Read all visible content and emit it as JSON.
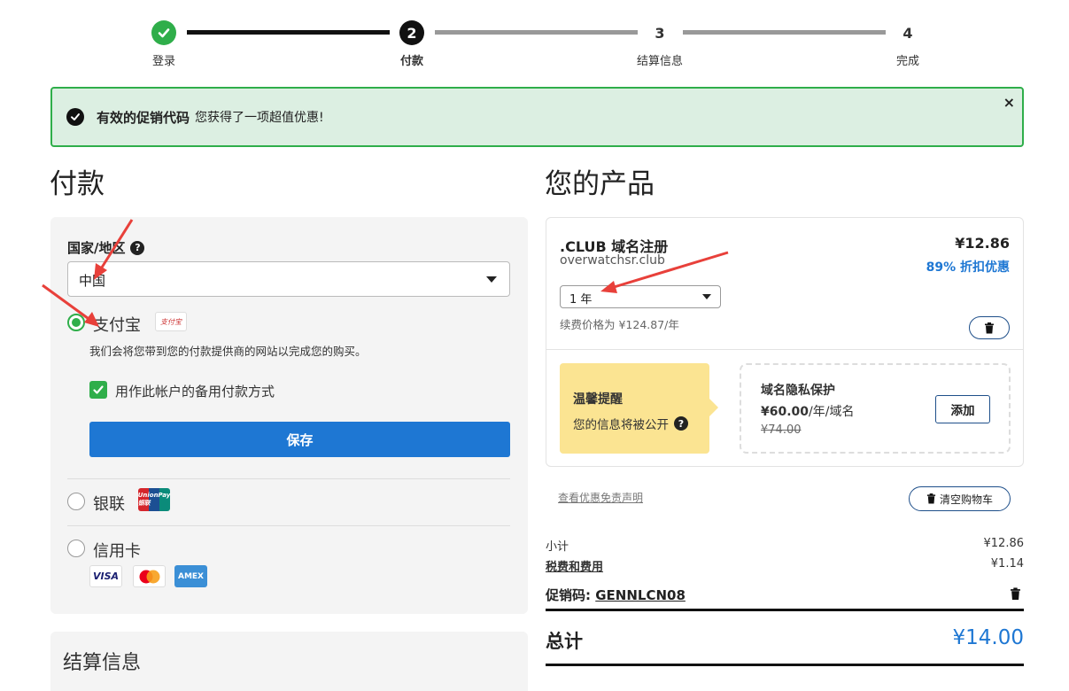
{
  "stepper": {
    "steps": [
      {
        "num": "",
        "label": "登录",
        "state": "done"
      },
      {
        "num": "2",
        "label": "付款",
        "state": "current"
      },
      {
        "num": "3",
        "label": "结算信息",
        "state": "pending"
      },
      {
        "num": "4",
        "label": "完成",
        "state": "pending"
      }
    ]
  },
  "alert": {
    "bold": "有效的促销代码",
    "text": "您获得了一项超值优惠!",
    "close": "×"
  },
  "payment": {
    "title": "付款",
    "country_label": "国家/地区",
    "country_value": "中国",
    "options": {
      "alipay": {
        "label": "支付宝",
        "logo_text": "支付宝",
        "description": "我们会将您带到您的付款提供商的网站以完成您的购买。",
        "checked": true
      },
      "unionpay": {
        "label": "银联",
        "logo_text": "UnionPay 银联",
        "checked": false
      },
      "card": {
        "label": "信用卡",
        "checked": false,
        "brands": [
          "VISA",
          "mastercard",
          "AMEX"
        ]
      }
    },
    "backup_checkbox_label": "用作此帐户的备用付款方式",
    "save_label": "保存"
  },
  "billing": {
    "title": "结算信息"
  },
  "products": {
    "title": "您的产品",
    "item": {
      "name": ".CLUB 域名注册",
      "domain": "overwatchsr.club",
      "price": "¥12.86",
      "discount": "89% 折扣优惠",
      "term": "1 年",
      "renewal": "续费价格为 ¥124.87/年"
    },
    "tip": {
      "title": "温馨提醒",
      "text": "您的信息将被公开"
    },
    "privacy": {
      "title": "域名隐私保护",
      "price": "¥60.00",
      "price_unit": "/年/域名",
      "old_price": "¥74.00",
      "add_label": "添加"
    },
    "disclaimer": "查看优惠免责声明",
    "clear_cart": "清空购物车"
  },
  "summary": {
    "subtotal_label": "小计",
    "subtotal": "¥12.86",
    "tax_label": "税费和费用",
    "tax": "¥1.14",
    "promo_label": "促销码:",
    "promo_code": "GENNLCN08",
    "total_label": "总计",
    "total": "¥14.00"
  },
  "colors": {
    "accent": "#1e77d3",
    "success": "#2fae4a",
    "alert_bg": "#dcefe2",
    "tip_bg": "#fbe492",
    "annotation": "#e8403a"
  }
}
